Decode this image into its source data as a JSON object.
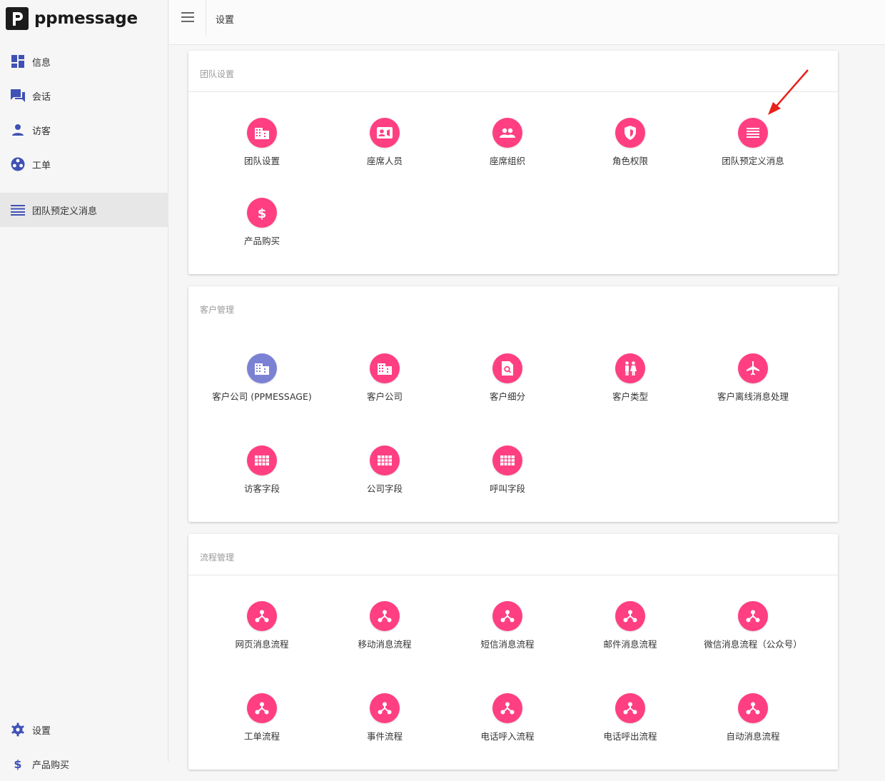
{
  "app": {
    "name": "ppmessage",
    "logo_letter": "p"
  },
  "topbar": {
    "title": "设置"
  },
  "sidebar": {
    "items": [
      {
        "label": "信息",
        "icon": "dashboard-icon"
      },
      {
        "label": "会话",
        "icon": "chat-icon"
      },
      {
        "label": "访客",
        "icon": "person-icon"
      },
      {
        "label": "工单",
        "icon": "film-reel-icon"
      }
    ],
    "active_item": {
      "label": "团队预定义消息",
      "icon": "list-icon"
    },
    "bottom_items": [
      {
        "label": "设置",
        "icon": "gear-icon"
      },
      {
        "label": "产品购买",
        "icon": "dollar-icon"
      }
    ]
  },
  "sections": [
    {
      "title": "团队设置",
      "tiles": [
        {
          "label": "团队设置",
          "icon": "building-icon"
        },
        {
          "label": "座席人员",
          "icon": "contact-card-icon"
        },
        {
          "label": "座席组织",
          "icon": "people-icon"
        },
        {
          "label": "角色权限",
          "icon": "shield-icon"
        },
        {
          "label": "团队预定义消息",
          "icon": "list-icon"
        },
        {
          "label": "产品购买",
          "icon": "dollar-icon"
        }
      ]
    },
    {
      "title": "客户管理",
      "tiles": [
        {
          "label": "客户公司 (PPMESSAGE)",
          "icon": "building-icon"
        },
        {
          "label": "客户公司",
          "icon": "building-icon"
        },
        {
          "label": "客户细分",
          "icon": "search-document-icon"
        },
        {
          "label": "客户类型",
          "icon": "wc-icon"
        },
        {
          "label": "客户离线消息处理",
          "icon": "airplane-icon"
        },
        {
          "label": "访客字段",
          "icon": "grid-icon"
        },
        {
          "label": "公司字段",
          "icon": "grid-icon"
        },
        {
          "label": "呼叫字段",
          "icon": "grid-icon"
        }
      ]
    },
    {
      "title": "流程管理",
      "tiles": [
        {
          "label": "网页消息流程",
          "icon": "flow-icon"
        },
        {
          "label": "移动消息流程",
          "icon": "flow-icon"
        },
        {
          "label": "短信消息流程",
          "icon": "flow-icon"
        },
        {
          "label": "邮件消息流程",
          "icon": "flow-icon"
        },
        {
          "label": "微信消息流程（公众号）",
          "icon": "flow-icon"
        },
        {
          "label": "工单流程",
          "icon": "flow-icon"
        },
        {
          "label": "事件流程",
          "icon": "flow-icon"
        },
        {
          "label": "电话呼入流程",
          "icon": "flow-icon"
        },
        {
          "label": "电话呼出流程",
          "icon": "flow-icon"
        },
        {
          "label": "自动消息流程",
          "icon": "flow-icon"
        }
      ]
    }
  ],
  "colors": {
    "accent": "#ff3f81",
    "accent_alt": "#7b82d4",
    "nav_icon": "#3f51b5",
    "annotation_arrow": "#e8211a"
  }
}
